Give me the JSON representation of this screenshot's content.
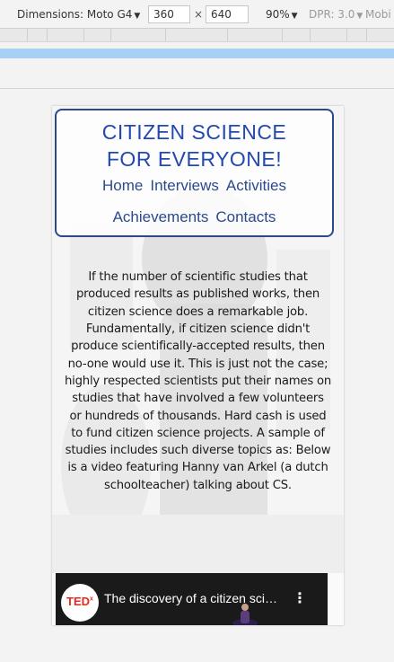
{
  "devtools": {
    "device_label": "Dimensions: Moto G4",
    "width_value": "360",
    "height_value": "640",
    "times": "×",
    "zoom": "90%",
    "dpr": "DPR: 3.0",
    "mobile": "Mobi"
  },
  "site": {
    "title_line1": "CITIZEN SCIENCE",
    "title_line2": "FOR EVERYONE!",
    "nav": [
      "Home",
      "Interviews",
      "Activities",
      "Achievements",
      "Contacts"
    ]
  },
  "intro": "If the number of scientific studies that produced results as published works, then citizen science does a remarkable job. Fundamentally, if citizen science didn't produce scientifically-accepted results, then no-one would use it. This is just not the case; highly respected scientists put their names on studies that have involved a few volunteers or hundreds of thousands. Hard cash is used to fund citizen science projects. A sample of studies includes such diverse topics as: Below is a video featuring Hanny van Arkel (a dutch schoolteacher) talking about CS.",
  "video": {
    "title": "The discovery of a citizen scientist",
    "logo_text": "TED",
    "logo_sup": "x"
  },
  "colors": {
    "accent": "#2349b0",
    "border": "#2b4a8e",
    "media_query_bar": "#a6d0f5"
  }
}
